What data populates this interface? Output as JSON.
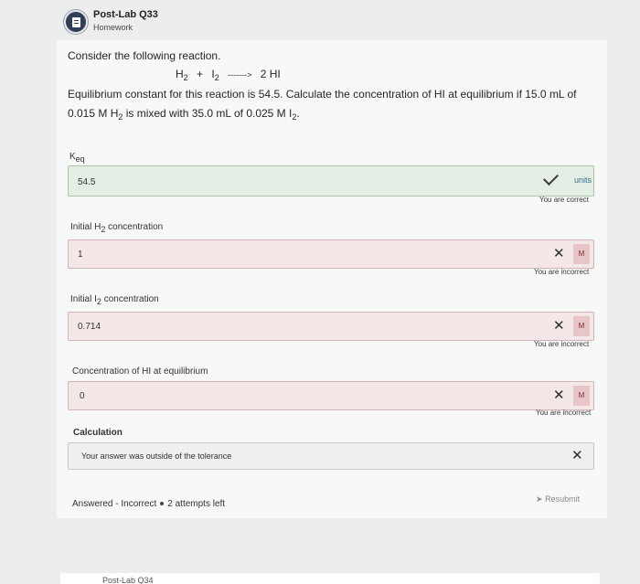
{
  "header": {
    "title": "Post-Lab Q33",
    "subtitle": "Homework",
    "icon": "homework-icon"
  },
  "question": {
    "intro": "Consider the following reaction.",
    "reaction": {
      "r1": "H",
      "r1_sub": "2",
      "plus": "+",
      "r2": "I",
      "r2_sub": "2",
      "arrow": "------->",
      "product": "2 HI"
    },
    "line1": "Equilibrium constant for this reaction is 54.5. Calculate the concentration of HI at equilibrium if 15.0 mL of",
    "line2_a": "0.015 M H",
    "line2_sub1": "2",
    "line2_b": " is mixed with 35.0 mL of 0.025 M I",
    "line2_sub2": "2",
    "line2_c": "."
  },
  "fields": {
    "keq": {
      "label": "K",
      "label_sub": "eq",
      "value": "54.5",
      "tag": "units",
      "status": "You are correct",
      "icon": "check-icon"
    },
    "h2": {
      "label_a": "Initial H",
      "label_sub": "2",
      "label_b": " concentration",
      "value": "1",
      "tag": "M",
      "status": "You are incorrect",
      "icon": "x-icon"
    },
    "i2": {
      "label_a": "Initial I",
      "label_sub": "2",
      "label_b": " concentration",
      "value": "0.714",
      "tag": "M",
      "status": "You are incorrect",
      "icon": "x-icon"
    },
    "hi": {
      "label": "Concentration of HI at equilibrium",
      "value": "0",
      "tag": "M",
      "status": "You are incorrect",
      "icon": "x-icon"
    },
    "calc": {
      "label": "Calculation",
      "value": "Your answer was outside of the tolerance",
      "icon": "x-icon"
    }
  },
  "footer": {
    "answered": "Answered - Incorrect",
    "attempts": "2 attempts left",
    "resubmit": "Resubmit"
  },
  "next_card": {
    "partial_title": "Post-Lab Q34"
  }
}
